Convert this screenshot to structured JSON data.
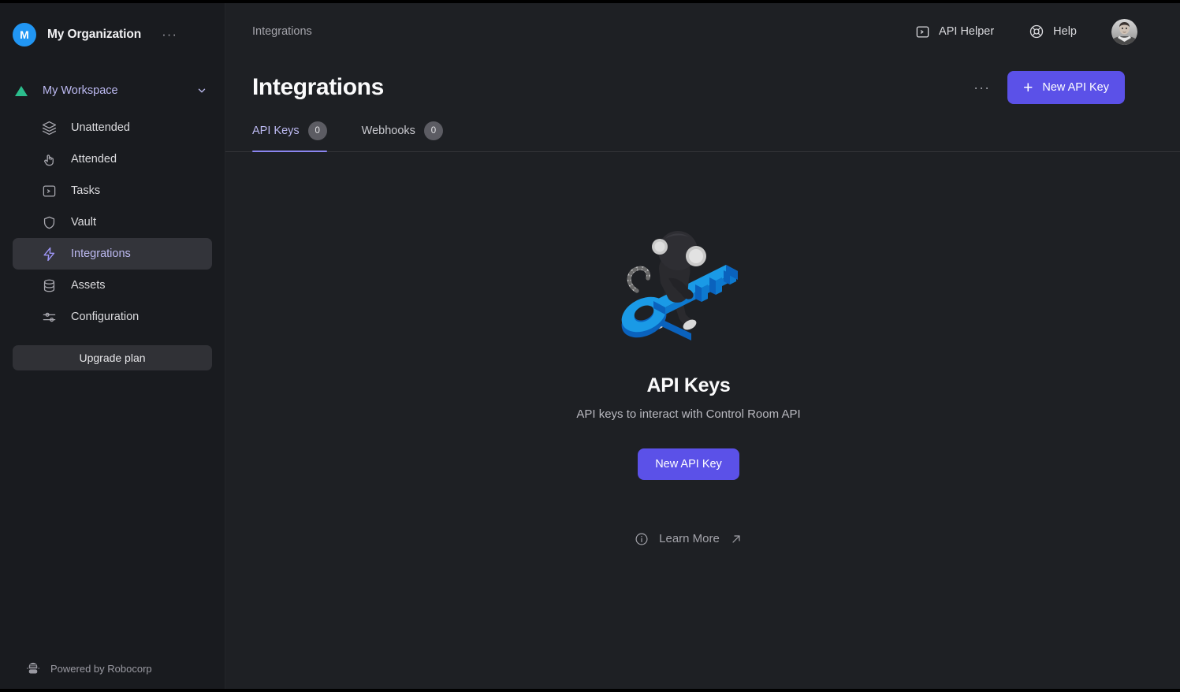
{
  "sidebar": {
    "org": {
      "avatar_initial": "M",
      "name": "My Organization",
      "menu_label": "···",
      "avatar_color": "#2196f3"
    },
    "workspace": {
      "label": "My Workspace",
      "marker_color": "#2bbd8c",
      "chevron_icon": "chevron-down-icon"
    },
    "items": [
      {
        "label": "Unattended",
        "icon": "layers-icon",
        "active": false
      },
      {
        "label": "Attended",
        "icon": "hand-pointer-icon",
        "active": false
      },
      {
        "label": "Tasks",
        "icon": "terminal-icon",
        "active": false
      },
      {
        "label": "Vault",
        "icon": "shield-icon",
        "active": false
      },
      {
        "label": "Integrations",
        "icon": "bolt-icon",
        "active": true
      },
      {
        "label": "Assets",
        "icon": "database-icon",
        "active": false
      },
      {
        "label": "Configuration",
        "icon": "sliders-icon",
        "active": false
      }
    ],
    "upgrade_label": "Upgrade plan",
    "footer": {
      "text": "Powered by Robocorp",
      "logo_icon": "robocorp-logo-icon"
    }
  },
  "topbar": {
    "breadcrumb": "Integrations",
    "api_helper_label": "API Helper",
    "api_helper_icon": "terminal-icon",
    "help_label": "Help",
    "help_icon": "lifebuoy-icon",
    "avatar_icon": "user-avatar"
  },
  "page": {
    "title": "Integrations",
    "more_menu_label": "···",
    "new_key_button": "New API Key",
    "plus_icon": "plus-icon",
    "accent_color": "#5b51e8"
  },
  "tabs": [
    {
      "label": "API Keys",
      "count": "0",
      "active": true
    },
    {
      "label": "Webhooks",
      "count": "0",
      "active": false
    }
  ],
  "empty_state": {
    "illustration_icon": "api-key-illustration",
    "title": "API Keys",
    "description": "API keys to interact with Control Room API",
    "button_label": "New API Key",
    "learn_more_label": "Learn More",
    "learn_more_icon": "info-circle-icon",
    "external_link_icon": "arrow-up-right-icon"
  }
}
